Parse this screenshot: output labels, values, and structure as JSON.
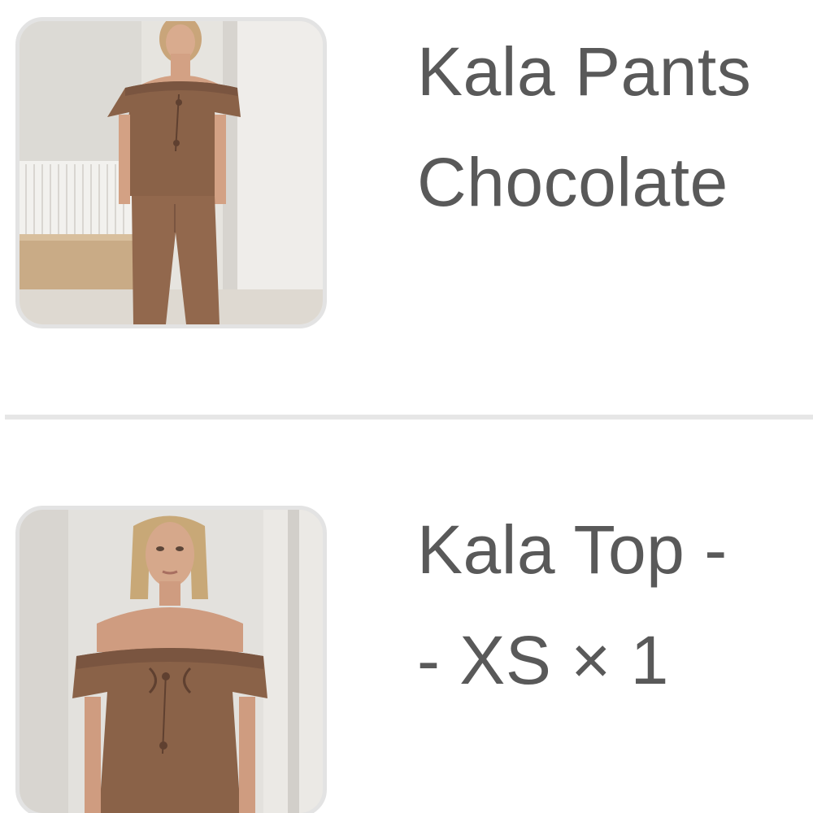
{
  "cart": {
    "items": [
      {
        "title_line1": "Kala Pants",
        "title_line2": "Chocolate",
        "image": "Model wearing chocolate brown off-shoulder top and wide-leg pants"
      },
      {
        "title_line1": "Kala Top -",
        "title_line2": "- XS × 1",
        "image": "Model wearing chocolate brown off-shoulder tie-front top"
      }
    ]
  },
  "colors": {
    "text": "#595959",
    "thumb_border": "#e3e3e3",
    "divider": "#e6e6e6",
    "garment": "#8a6248"
  }
}
